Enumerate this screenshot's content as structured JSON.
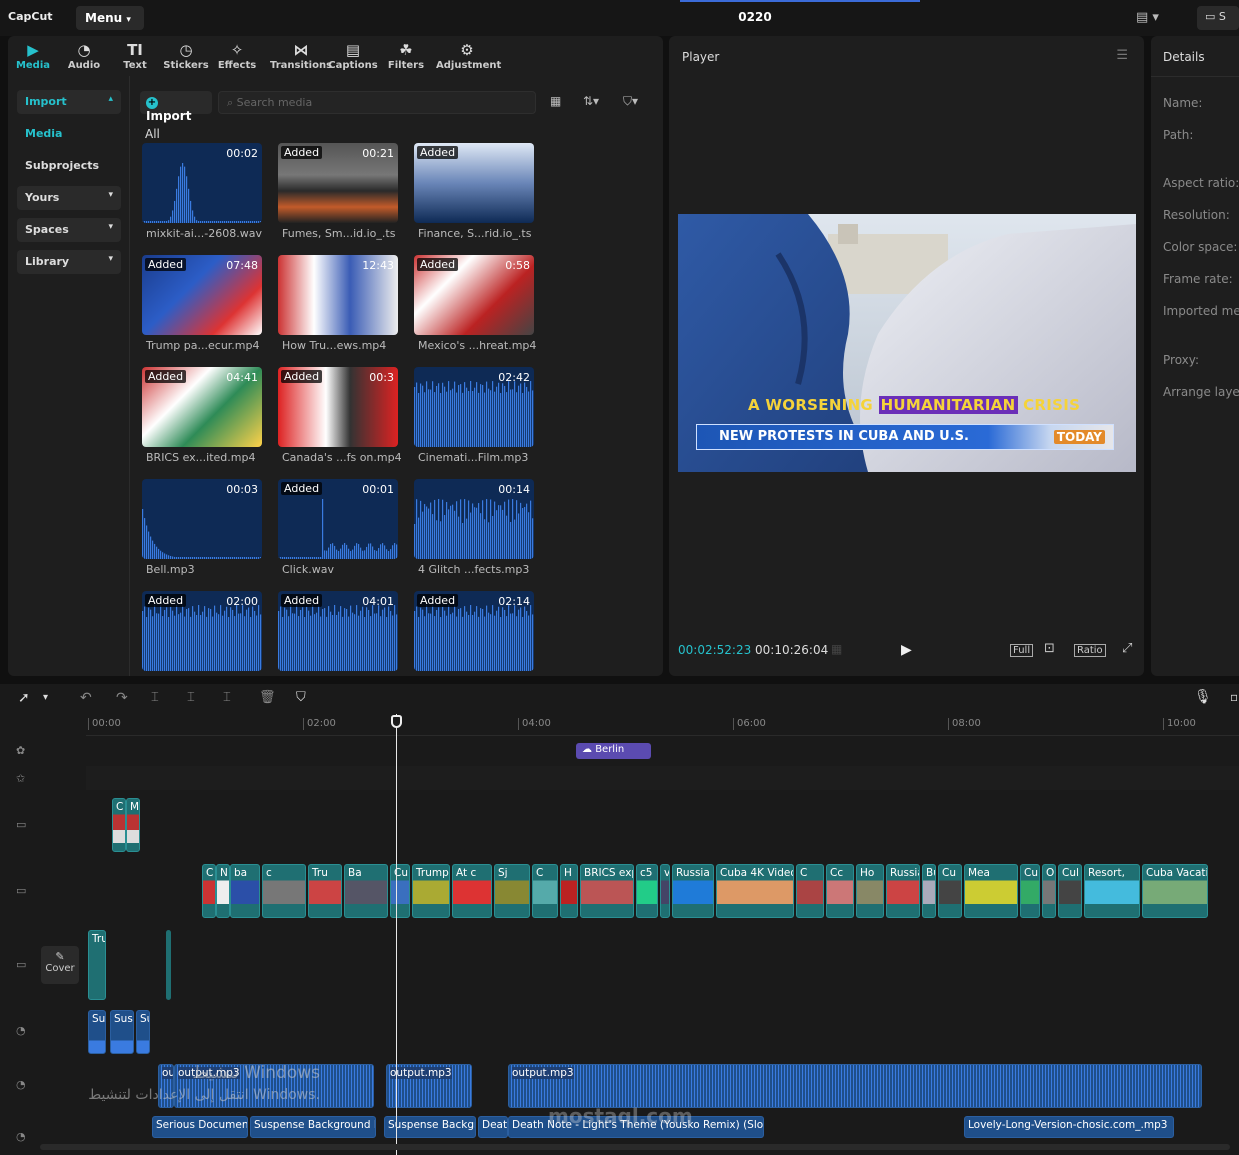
{
  "app": {
    "logo": "CapCut",
    "menu_label": "Menu",
    "project_title": "0220"
  },
  "toolbar": [
    {
      "label": "Media",
      "icon": "media-icon"
    },
    {
      "label": "Audio",
      "icon": "audio-icon"
    },
    {
      "label": "Text",
      "icon": "text-icon"
    },
    {
      "label": "Stickers",
      "icon": "sticker-icon"
    },
    {
      "label": "Effects",
      "icon": "effects-icon"
    },
    {
      "label": "Transitions",
      "icon": "transitions-icon"
    },
    {
      "label": "Captions",
      "icon": "captions-icon"
    },
    {
      "label": "Filters",
      "icon": "filters-icon"
    },
    {
      "label": "Adjustment",
      "icon": "adjustment-icon"
    }
  ],
  "sidebar": {
    "import": "Import",
    "media": "Media",
    "subprojects": "Subprojects",
    "yours": "Yours",
    "spaces": "Spaces",
    "library": "Library"
  },
  "media": {
    "import_button": "Import",
    "search_placeholder": "Search media",
    "filter_label": "All",
    "items": [
      {
        "name": "mixkit-ai...-2608.wav",
        "duration": "00:02",
        "added": false
      },
      {
        "name": "Fumes, Sm...id.io_.ts",
        "duration": "00:21",
        "added": true
      },
      {
        "name": "Finance, S...rid.io_.ts",
        "duration": "",
        "added": true
      },
      {
        "name": "Trump pa...ecur.mp4",
        "duration": "07:48",
        "added": true
      },
      {
        "name": "How Tru...ews.mp4",
        "duration": "12:43",
        "added": false
      },
      {
        "name": "Mexico's ...hreat.mp4",
        "duration": "0:58",
        "added": true
      },
      {
        "name": "BRICS ex...ited.mp4",
        "duration": "04:41",
        "added": true
      },
      {
        "name": "Canada's ...fs on.mp4",
        "duration": "00:3",
        "added": true
      },
      {
        "name": "Cinemati...Film.mp3",
        "duration": "02:42",
        "added": false
      },
      {
        "name": "Bell.mp3",
        "duration": "00:03",
        "added": false
      },
      {
        "name": "Click.wav",
        "duration": "00:01",
        "added": true
      },
      {
        "name": "4 Glitch ...fects.mp3",
        "duration": "00:14",
        "added": false
      },
      {
        "name": "",
        "duration": "02:00",
        "added": true
      },
      {
        "name": "",
        "duration": "04:01",
        "added": true
      },
      {
        "name": "",
        "duration": "02:14",
        "added": true
      }
    ],
    "added_label": "Added"
  },
  "player": {
    "title": "Player",
    "overlay_top": "A WORSENING HUMANITARIAN CRISIS",
    "overlay_highlight": "HUMANITARIAN",
    "overlay_lower": "NEW PROTESTS IN CUBA AND U.S.",
    "overlay_brand": "TODAY",
    "current_time": "00:02:52:23",
    "total_time": "00:10:26:04",
    "full_label": "Full",
    "ratio_label": "Ratio"
  },
  "details": {
    "title": "Details",
    "fields": [
      "Name:",
      "Path:",
      "Aspect ratio:",
      "Resolution:",
      "Color space:",
      "Frame rate:",
      "Imported me",
      "Proxy:",
      "Arrange laye"
    ]
  },
  "timeline": {
    "ruler": [
      "00:00",
      "02:00",
      "04:00",
      "06:00",
      "08:00",
      "10:00"
    ],
    "effect_clip": "Berlin",
    "cover_label": "Cover",
    "main_clip_labels": [
      "C",
      "N",
      "ba",
      "c",
      "Tru",
      "Ba",
      "Cu",
      "Trump",
      "At c",
      "Sj",
      "C",
      "H",
      "BRICS exp",
      "c5",
      "v",
      "Russia",
      "Cuba 4K Video",
      "C",
      "Cc",
      "Ho",
      "Russia",
      "Bu",
      "Cu",
      "Mea",
      "Cu",
      "O",
      "Cul",
      "Resort,",
      "Cuba Vacati"
    ],
    "overlay_clip_labels": [
      "C",
      "M"
    ],
    "lower_clip_label": "Tru",
    "sfx_labels": [
      "Sus",
      "Sus|",
      "Su"
    ],
    "audio_labels": [
      "ou",
      "output.mp3",
      "output.mp3",
      "output.mp3"
    ],
    "music_labels": [
      "Serious Documen",
      "Suspense Background M",
      "Suspense Backgr",
      "Deatl",
      "Death Note - Light's Theme (Yousko Remix) (Slo",
      "Lovely-Long-Version-chosic.com_.mp3"
    ],
    "watermark_line1": "تنشيط Windows",
    "watermark_line2": "انتقل إلى الإعدادات لتنشيط Windows.",
    "site_watermark": "mostaql.com"
  },
  "colors": {
    "accent": "#26c1cc",
    "video_clip": "#1f6f72",
    "audio_clip": "#1f4f8a",
    "effect_clip": "#5b4bb0"
  }
}
